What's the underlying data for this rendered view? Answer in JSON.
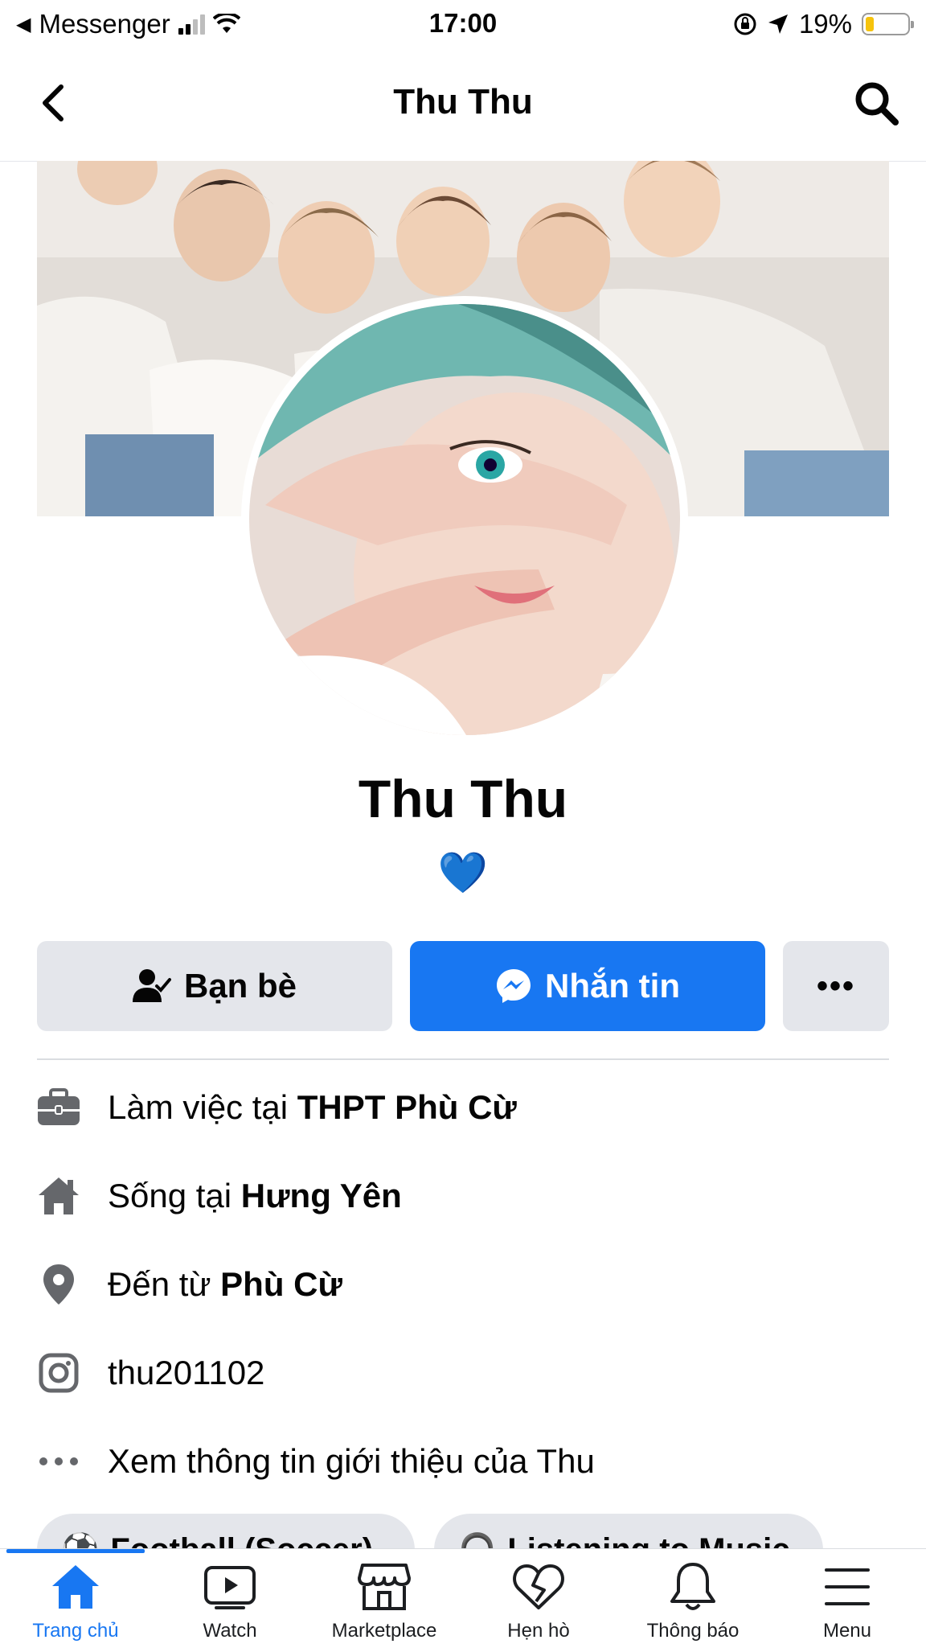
{
  "status_bar": {
    "back_app": "Messenger",
    "time": "17:00",
    "battery_percent": "19%",
    "battery_level": 0.19,
    "signal_bars": 2
  },
  "header": {
    "title": "Thu Thu"
  },
  "profile": {
    "name": "Thu Thu",
    "bio": "💙"
  },
  "actions": {
    "friends_label": "Bạn bè",
    "message_label": "Nhắn tin",
    "more_label": "•••"
  },
  "intro": [
    {
      "icon": "briefcase-icon",
      "prefix": "Làm việc tại ",
      "bold": "THPT Phù Cừ"
    },
    {
      "icon": "home-icon",
      "prefix": "Sống tại ",
      "bold": "Hưng Yên"
    },
    {
      "icon": "location-pin-icon",
      "prefix": "Đến từ ",
      "bold": "Phù Cừ"
    },
    {
      "icon": "instagram-icon",
      "prefix": "thu201102",
      "bold": ""
    },
    {
      "icon": "more-dots-icon",
      "prefix": "Xem thông tin giới thiệu của Thu",
      "bold": ""
    }
  ],
  "chips": [
    {
      "icon": "soccer-ball-icon",
      "label": "Football (Soccer)"
    },
    {
      "icon": "headphones-icon",
      "label": "Listening to Music"
    }
  ],
  "tabs": [
    {
      "label": "Trang chủ",
      "icon": "home-icon",
      "active": true
    },
    {
      "label": "Watch",
      "icon": "video-play-icon",
      "active": false
    },
    {
      "label": "Marketplace",
      "icon": "store-icon",
      "active": false
    },
    {
      "label": "Hẹn hò",
      "icon": "heart-icon",
      "active": false
    },
    {
      "label": "Thông báo",
      "icon": "bell-icon",
      "active": false
    },
    {
      "label": "Menu",
      "icon": "hamburger-icon",
      "active": false
    }
  ],
  "colors": {
    "accent": "#1877f2",
    "button_gray": "#e4e6eb",
    "icon_gray": "#65676b"
  }
}
